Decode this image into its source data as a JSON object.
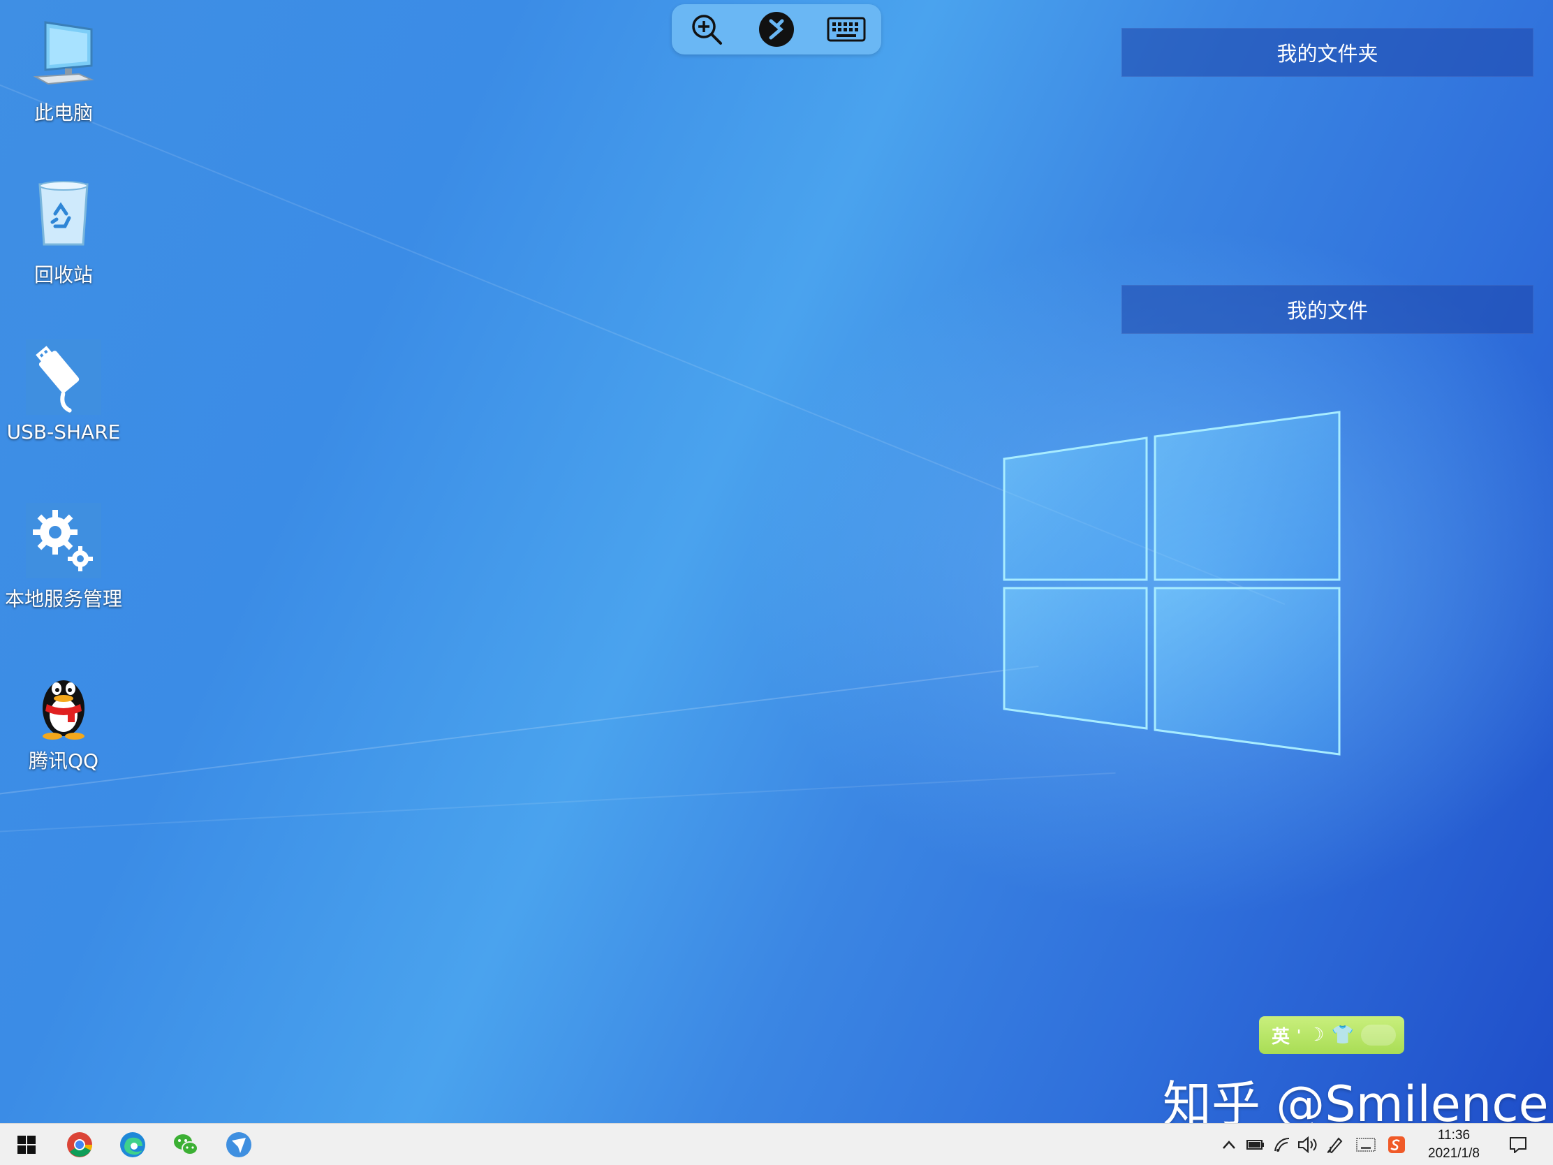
{
  "desktop": {
    "icons": [
      {
        "label": "此电脑",
        "icon": "computer-icon"
      },
      {
        "label": "回收站",
        "icon": "recycle-bin-icon"
      },
      {
        "label": "USB-SHARE",
        "icon": "usb-share-icon"
      },
      {
        "label": "本地服务管理",
        "icon": "gears-icon"
      },
      {
        "label": "腾讯QQ",
        "icon": "qq-penguin-icon"
      }
    ]
  },
  "remote_toolbar": {
    "buttons": [
      "zoom-in-icon",
      "remote-connect-icon",
      "keyboard-icon"
    ]
  },
  "panels": {
    "my_folder": "我的文件夹",
    "my_files": "我的文件"
  },
  "ime": {
    "mode": "英"
  },
  "watermark": "知乎 @Smilence",
  "taskbar": {
    "apps": [
      "windows-start-icon",
      "chrome-icon",
      "edge-icon",
      "wechat-icon",
      "feishu-icon"
    ],
    "tray": [
      "chevron-up-icon",
      "battery-icon",
      "wifi-icon",
      "volume-icon",
      "pen-icon",
      "keyboard-tray-icon",
      "sogou-icon"
    ],
    "time": "11:36",
    "date": "2021/1/8"
  },
  "colors": {
    "toolbar": "#6ab7f4",
    "panel": "#2a54b6",
    "ime": "#b5e265",
    "taskbar": "#f0f0f0"
  }
}
